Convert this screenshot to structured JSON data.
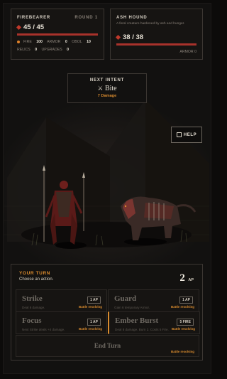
{
  "player": {
    "name": "FIREBEARER",
    "round": "ROUND 1",
    "hp": "45 / 45",
    "hp_fraction": 1.0,
    "stats": [
      {
        "label": "FIRE",
        "value": "100"
      },
      {
        "label": "ARMOR",
        "value": "0"
      },
      {
        "label": "OBOL",
        "value": "10"
      }
    ],
    "stats2": [
      {
        "label": "RELICS",
        "value": "0"
      },
      {
        "label": "UPGRADES",
        "value": "0"
      }
    ]
  },
  "enemy": {
    "name": "ASH HOUND",
    "description": "A feral creature hardened by ash and hunger.",
    "hp": "38 / 38",
    "hp_fraction": 1.0,
    "armor": "ARMOR 0"
  },
  "intent": {
    "label": "NEXT INTENT",
    "name": "Bite",
    "detail": "7 Damage"
  },
  "help_label": "HELP",
  "turn": {
    "title": "YOUR TURN",
    "subtitle": "Choose an action.",
    "ap_value": "2",
    "ap_unit": "AP"
  },
  "actions": [
    {
      "name": "Strike",
      "desc": "Deal 6 damage.",
      "cost": "1 AP",
      "status": "Battle resolving"
    },
    {
      "name": "Guard",
      "desc": "Gain 6 temporary Armor.",
      "cost": "1 AP",
      "status": "Battle resolving"
    },
    {
      "name": "Focus",
      "desc": "Next Strike deals +4 damage.",
      "cost": "1 AP",
      "status": "Battle resolving"
    },
    {
      "name": "Ember Burst",
      "desc": "Deal 8 damage. Burn 2. Costs 5 Fire.",
      "cost": "5 FIRE",
      "status": "Battle resolving"
    }
  ],
  "end_turn": {
    "label": "End Turn",
    "status": "Battle resolving"
  },
  "colors": {
    "accent": "#d98b2e",
    "hp": "#a8322b",
    "background": "#0c0b0a"
  }
}
